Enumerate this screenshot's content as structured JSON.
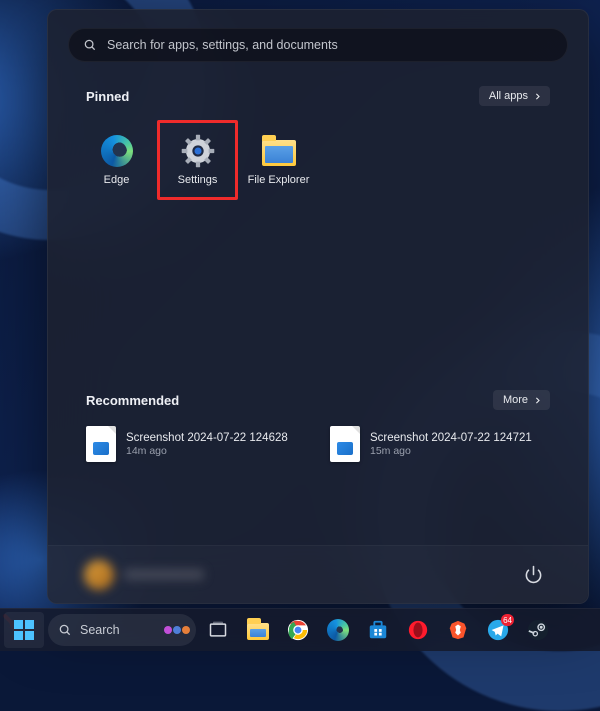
{
  "search": {
    "placeholder": "Search for apps, settings, and documents"
  },
  "pinned": {
    "header": "Pinned",
    "all_apps_label": "All apps",
    "items": [
      {
        "label": "Edge"
      },
      {
        "label": "Settings"
      },
      {
        "label": "File Explorer"
      }
    ],
    "highlighted_index": 1
  },
  "recommended": {
    "header": "Recommended",
    "more_label": "More",
    "items": [
      {
        "title": "Screenshot 2024-07-22 124628",
        "sub": "14m ago"
      },
      {
        "title": "Screenshot 2024-07-22 124721",
        "sub": "15m ago"
      }
    ]
  },
  "footer": {},
  "taskbar": {
    "search_label": "Search",
    "telegram_badge": "64"
  },
  "colors": {
    "highlight": "#ef2b2b",
    "panel_bg": "rgba(28,33,48,0.88)"
  }
}
